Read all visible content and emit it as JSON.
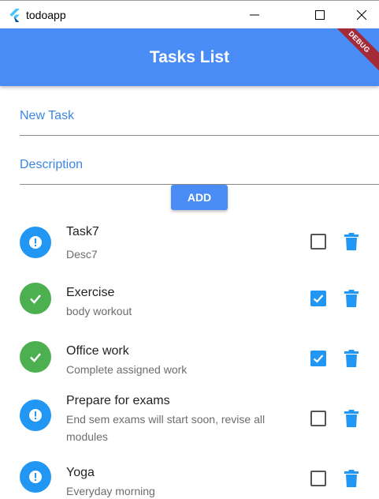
{
  "window": {
    "title": "todoapp",
    "logo_icon": "flutter-logo-icon",
    "minimize_icon": "minimize-icon",
    "maximize_icon": "maximize-icon",
    "close_icon": "close-icon"
  },
  "appbar": {
    "title": "Tasks List",
    "debug_banner": "DEBUG",
    "color": "#4a8cf5",
    "banner_color": "#a52a38"
  },
  "form": {
    "task_placeholder": "New Task",
    "description_placeholder": "Description",
    "add_label": "ADD"
  },
  "tasks": [
    {
      "title": "Task7",
      "description": "Desc7",
      "done": false
    },
    {
      "title": "Exercise",
      "description": "body workout",
      "done": true
    },
    {
      "title": "Office work",
      "description": "Complete assigned work",
      "done": true
    },
    {
      "title": "Prepare for exams",
      "description": "End sem exams will start soon, revise all modules",
      "done": false
    },
    {
      "title": "Yoga",
      "description": "Everyday morning",
      "done": false
    }
  ],
  "colors": {
    "pending": "#2196f3",
    "done": "#4caf50",
    "checkbox_checked": "#2196f3",
    "trash": "#2196f3"
  },
  "icons": {
    "pending": "exclamation-icon",
    "done": "check-icon",
    "delete": "trash-icon"
  }
}
